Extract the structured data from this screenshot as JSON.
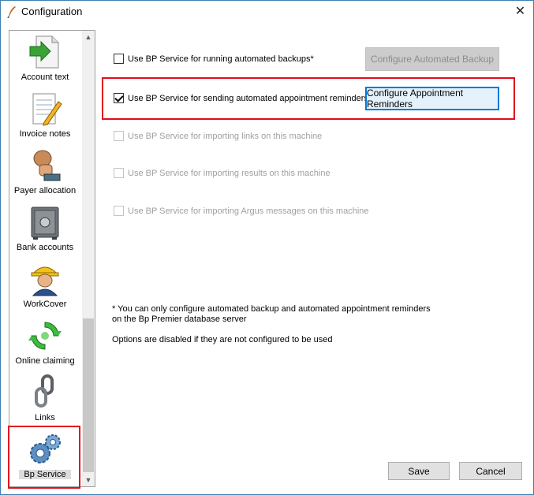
{
  "window": {
    "title": "Configuration"
  },
  "sidebar": {
    "items": [
      {
        "label": "Account text",
        "icon": "document-arrow-icon"
      },
      {
        "label": "Invoice notes",
        "icon": "notepad-pencil-icon"
      },
      {
        "label": "Payer allocation",
        "icon": "hand-coins-icon"
      },
      {
        "label": "Bank accounts",
        "icon": "safe-icon"
      },
      {
        "label": "WorkCover",
        "icon": "worker-hardhat-icon"
      },
      {
        "label": "Online claiming",
        "icon": "green-refresh-icon"
      },
      {
        "label": "Links",
        "icon": "chain-link-icon"
      },
      {
        "label": "Bp Service",
        "icon": "gears-icon",
        "selected": true
      }
    ]
  },
  "options": {
    "backup": {
      "label": "Use BP Service for running automated backups*",
      "checked": false,
      "enabled": true
    },
    "reminders": {
      "label": "Use BP Service for sending automated appointment reminders",
      "checked": true,
      "enabled": true
    },
    "links": {
      "label": "Use BP Service for importing links on this machine",
      "checked": false,
      "enabled": false
    },
    "results": {
      "label": "Use BP Service for importing results on this machine",
      "checked": false,
      "enabled": false
    },
    "argus": {
      "label": "Use BP Service for importing Argus messages on this machine",
      "checked": false,
      "enabled": false
    }
  },
  "buttons": {
    "configure_backup": "Configure Automated Backup",
    "configure_reminders": "Configure Appointment Reminders",
    "save": "Save",
    "cancel": "Cancel"
  },
  "notes": {
    "line1": "* You can only configure automated backup and automated appointment reminders",
    "line2": "on the Bp Premier database server",
    "line3": "Options are disabled if they are not configured to be used"
  },
  "colors": {
    "highlight_box": "#e30d1c",
    "focus_border": "#0078d7"
  }
}
